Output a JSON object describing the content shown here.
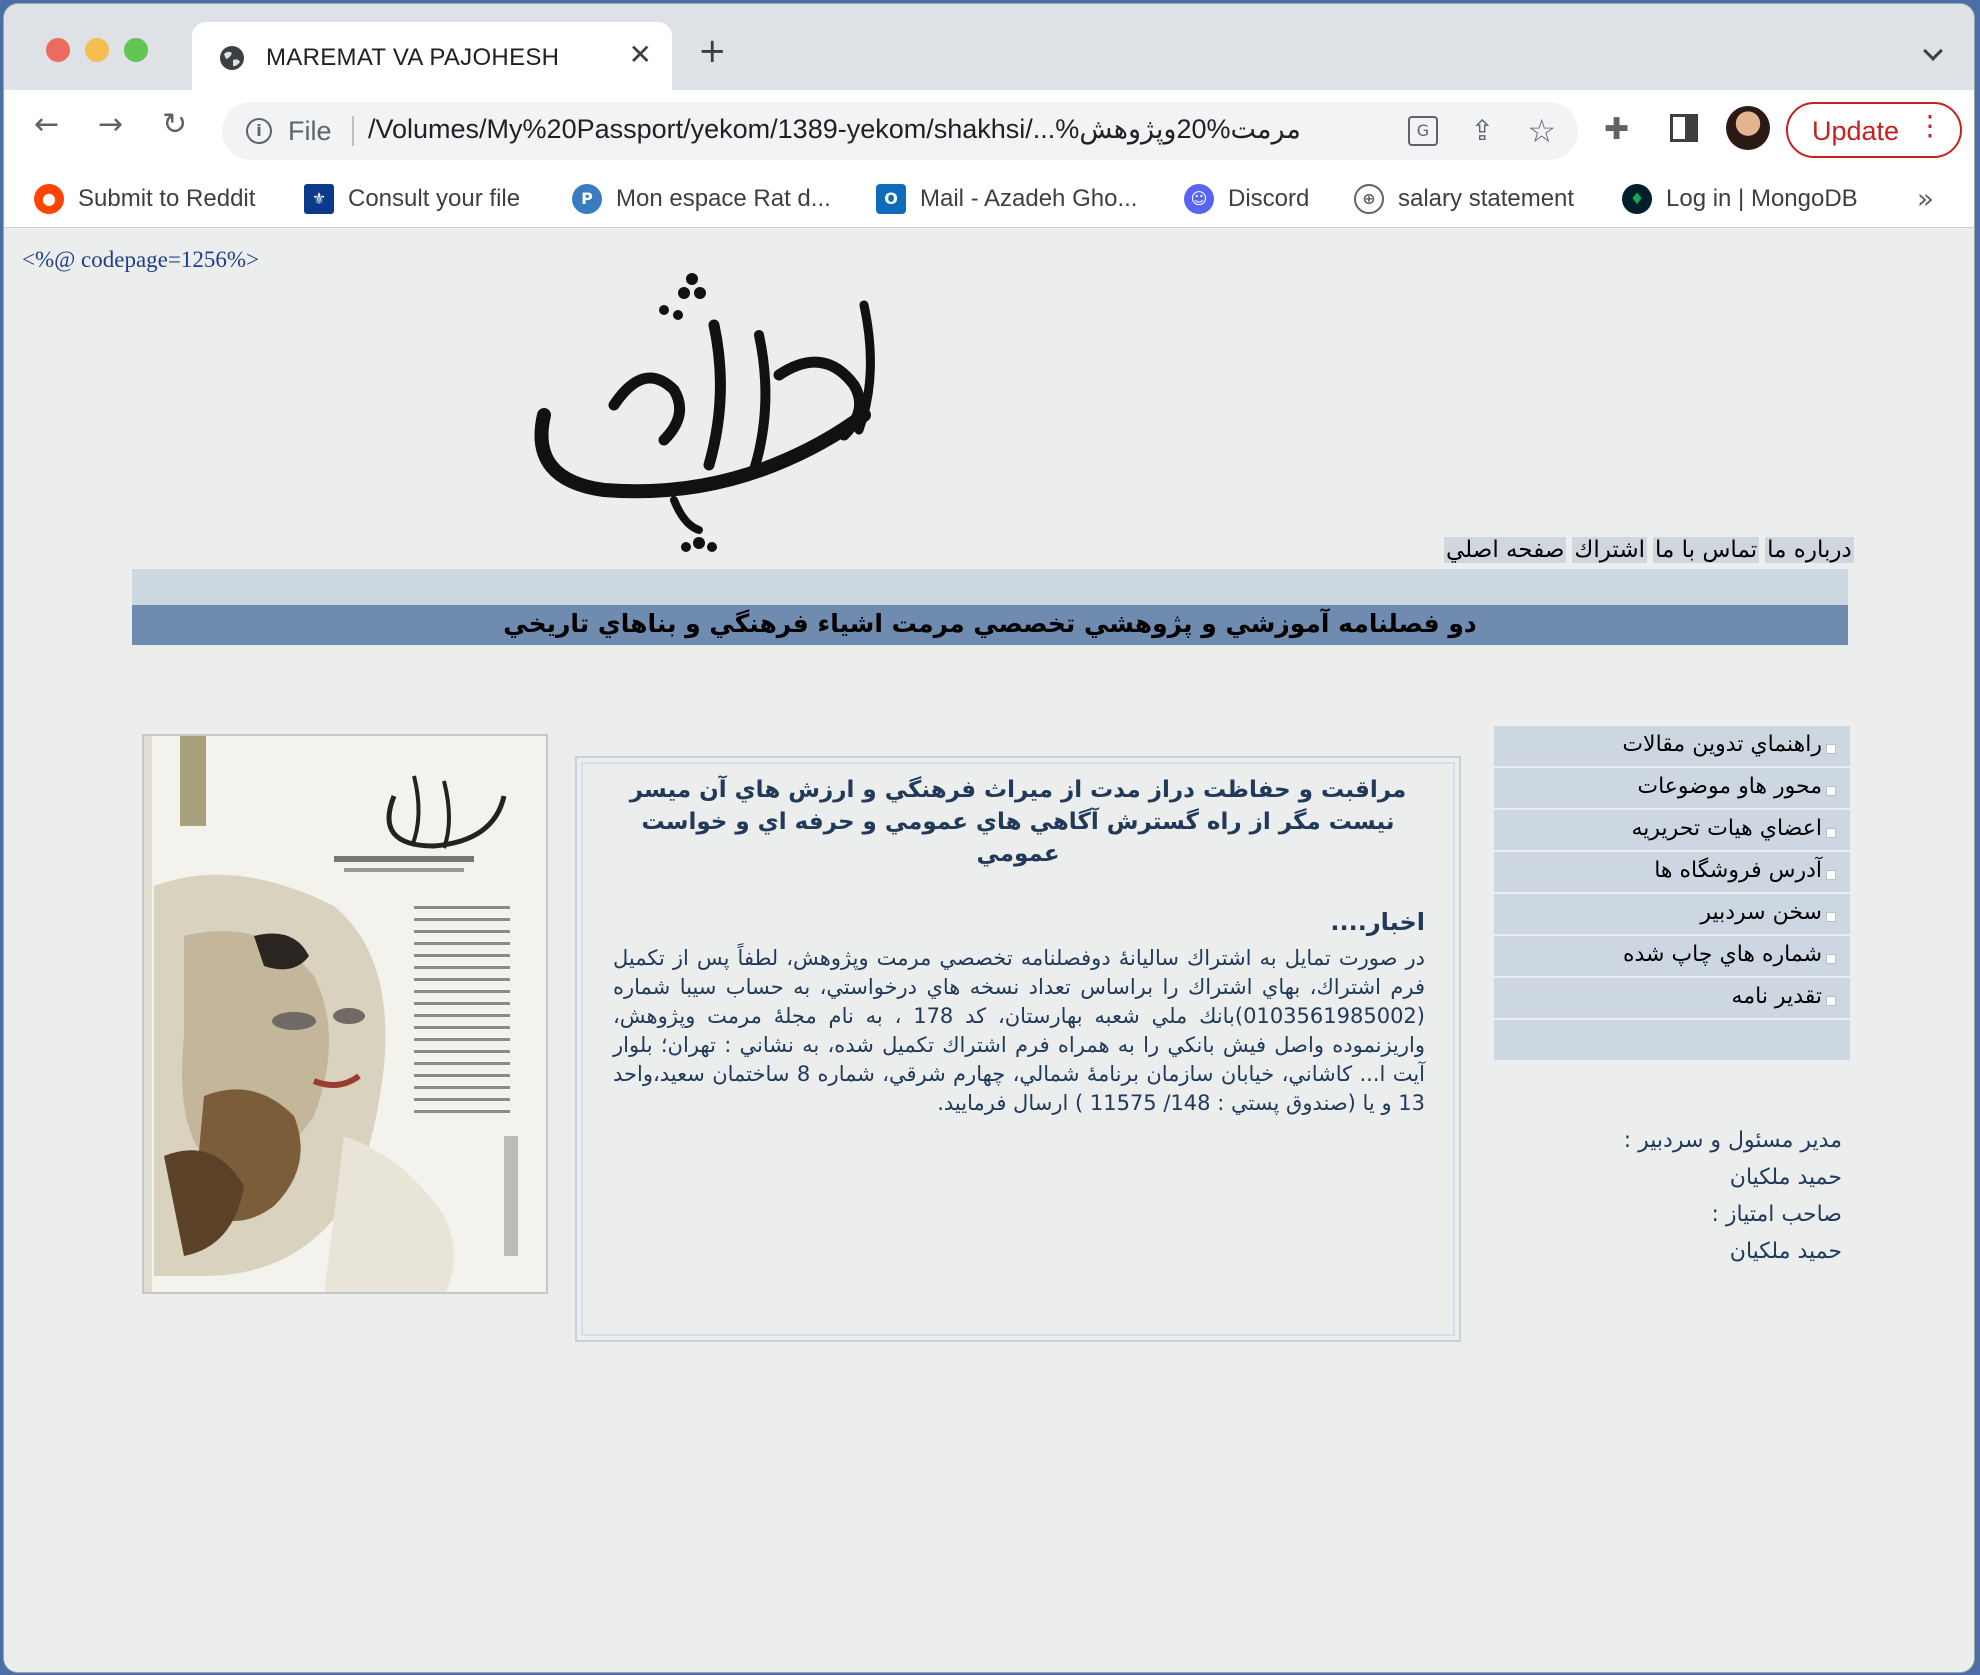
{
  "browser": {
    "tab_title": "MAREMAT VA PAJOHESH",
    "omnibox_prefix": "File",
    "url": "/Volumes/My%20Passport/yekom/1389-yekom/shakhsi/...%مرمت%20وپژوهش",
    "update_label": "Update",
    "bookmarks": [
      {
        "label": "Submit to Reddit",
        "icon": "reddit-icon",
        "color": "#ff4500"
      },
      {
        "label": "Consult your file",
        "icon": "fleur-de-lis-icon",
        "color": "#0b3a8c"
      },
      {
        "label": "Mon espace Rat d...",
        "icon": "p-circle-icon",
        "color": "#3b7bbf"
      },
      {
        "label": "Mail - Azadeh Gho...",
        "icon": "outlook-icon",
        "color": "#0f6cbd"
      },
      {
        "label": "Discord",
        "icon": "discord-icon",
        "color": "#5865f2"
      },
      {
        "label": "salary statement",
        "icon": "globe-icon",
        "color": "#5f6368"
      },
      {
        "label": "Log in | MongoDB",
        "icon": "mongodb-leaf-icon",
        "color": "#13aa52"
      }
    ]
  },
  "page": {
    "codepage": "<%@ codepage=1256%>",
    "logo_text": "مرمت و پژوهش",
    "top_nav": [
      "درباره ما",
      "تماس با ما",
      "اشتراك",
      "صفحه اصلي"
    ],
    "banner_title": "دو فصلنامه آموزشي و پژوهشي تخصصي مرمت اشياء فرهنگي و بناهاي تاريخي",
    "quote": "مراقبت و حفاظت دراز مدت از ميراث فرهنگي و ارزش هاي آن ميسر نيست مگر از راه گسترش آگاهي هاي عمومي و حرفه اي و خواست عمومي",
    "news_title": "اخبار....",
    "news_body": "در صورت تمايل به اشتراك ساليانهٔ دوفصلنامه تخصصي مرمت وپژوهش، لطفاً پس از تكميل فرم اشتراك، بهاي اشتراك را براساس تعداد نسخه هاي درخواستي، به حساب سيبا شماره (0103561985002)بانك ملي شعبه بهارستان، كد 178 ، به نام مجلهٔ مرمت وپژوهش، واريزنموده واصل فيش بانكي را به همراه فرم اشتراك تكميل شده، به نشاني : تهران؛ بلوار آيت ا... كاشاني، خيابان سازمان برنامهٔ شمالي، چهارم شرقي، شماره 8 ساختمان سعيد،واحد 13 و يا (صندوق پستي : 148/ 11575 ) ارسال فرماييد.",
    "side_menu": [
      "راهنماي تدوين مقالات",
      "محور هاو موضوعات",
      "اعضاي هيات تحريريه",
      "آدرس فروشگاه ها",
      "سخن سردبير",
      "شماره هاي چاپ شده",
      "تقدير نامه"
    ],
    "credits": {
      "editor_label": "مدير مسئول و سردبير :",
      "editor_name": "حميد ملكيان",
      "owner_label": "صاحب امتياز :",
      "owner_name": "حميد ملكيان"
    },
    "cover": {
      "logo_text": "مرمت و پژوهش",
      "issue_number": "۲",
      "subtitle": "دوفصلنامه تخصصي"
    }
  }
}
